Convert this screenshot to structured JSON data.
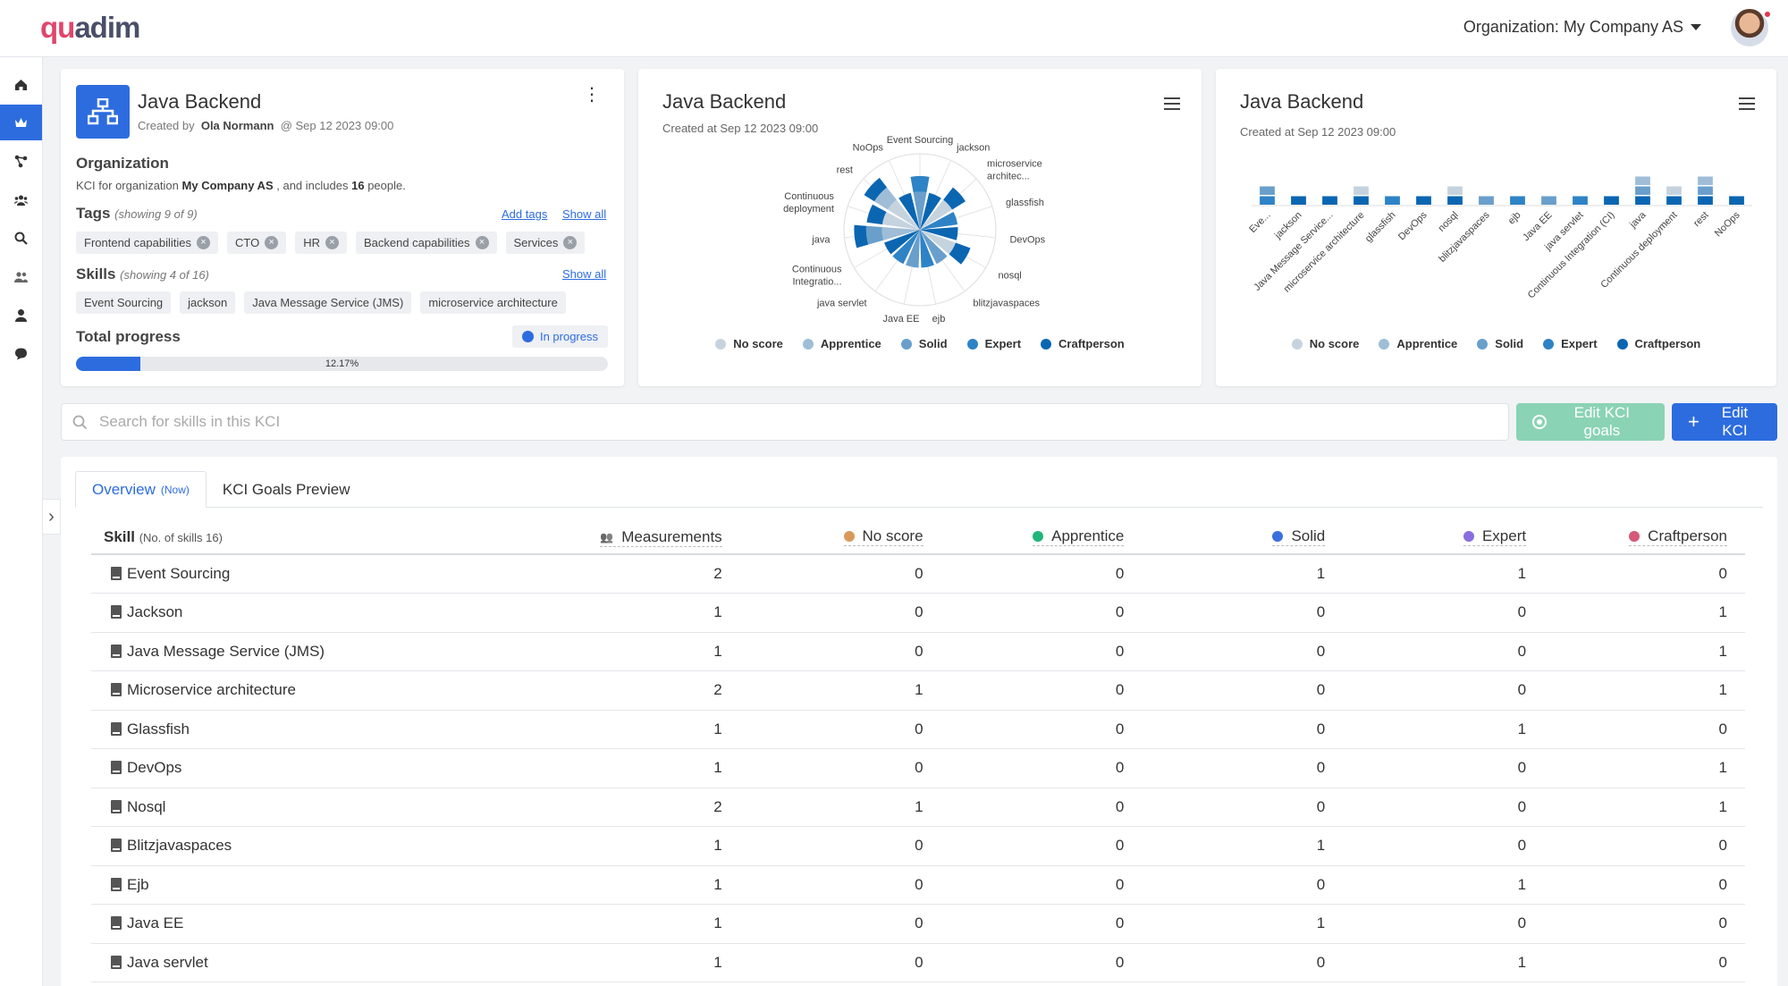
{
  "app": {
    "logo_text_a": "qu",
    "logo_text_b": "adim",
    "organization_label": "Organization: My Company AS"
  },
  "sidebar": {
    "items": [
      {
        "icon": "home-icon",
        "active": false
      },
      {
        "icon": "crown-icon",
        "active": true
      },
      {
        "icon": "graph-icon",
        "active": false
      },
      {
        "icon": "team-icon",
        "active": false
      },
      {
        "icon": "search-icon",
        "active": false
      },
      {
        "icon": "users-icon",
        "active": false
      },
      {
        "icon": "user-icon",
        "active": false
      },
      {
        "icon": "chat-icon",
        "active": false
      }
    ],
    "expander": "›"
  },
  "kci_card": {
    "title": "Java Backend",
    "created_prefix": "Created by",
    "created_by": "Ola Normann",
    "created_suffix": "@ Sep 12 2023 09:00",
    "organization_heading": "Organization",
    "org_desc_prefix": "KCI for organization",
    "org_name": "My Company AS",
    "org_desc_mid": ", and includes",
    "org_people": "16",
    "org_desc_suffix": "people.",
    "tags_heading": "Tags",
    "tags_note": "(showing 9 of 9)",
    "add_tags": "Add tags",
    "show_all_tags": "Show all",
    "tags": [
      "Frontend capabilities",
      "CTO",
      "HR",
      "Backend capabilities",
      "Services"
    ],
    "skills_heading": "Skills",
    "skills_note": "(showing 4 of 16)",
    "show_all_skills": "Show all",
    "skills": [
      "Event Sourcing",
      "jackson",
      "Java Message Service (JMS)",
      "microservice architecture"
    ],
    "progress_heading": "Total progress",
    "status": "In progress",
    "progress_fraction": 0.1217,
    "progress_label": "12.17%"
  },
  "colors": {
    "no_score": "#c5d3df",
    "apprentice": "#9fbdd7",
    "solid": "#6a9fcb",
    "expert": "#2e83c6",
    "craftperson": "#0b66b2",
    "accent": "#2d6cdf",
    "success": "#8ad3b5"
  },
  "legend": [
    "No score",
    "Apprentice",
    "Solid",
    "Expert",
    "Craftperson"
  ],
  "polar_card": {
    "title": "Java Backend",
    "subtitle": "Created at Sep 12 2023 09:00"
  },
  "bar_card": {
    "title": "Java Backend",
    "subtitle": "Created at Sep 12 2023 09:00"
  },
  "chart_data": [
    {
      "type": "polar-bar",
      "title": "Java Backend",
      "categories": [
        "Event Sourcing",
        "jackson",
        "microservice architec...",
        "glassfish",
        "DevOps",
        "nosql",
        "blitzjavaspaces",
        "ejb",
        "Java EE",
        "java servlet",
        "Continuous Integratio...",
        "java",
        "Continuous deployment",
        "rest",
        "NoOps"
      ],
      "series": [
        {
          "name": "No score",
          "values": [
            0,
            0,
            1,
            0,
            0,
            1,
            0,
            0,
            0,
            0,
            0,
            0,
            1,
            1,
            0
          ]
        },
        {
          "name": "Apprentice",
          "values": [
            0,
            0,
            0,
            0,
            0,
            0,
            0,
            0,
            0,
            0,
            0,
            1,
            0,
            1,
            0
          ]
        },
        {
          "name": "Solid",
          "values": [
            1,
            0,
            0,
            0,
            0,
            0,
            1,
            0,
            1,
            0,
            0,
            1,
            0,
            0,
            0
          ]
        },
        {
          "name": "Expert",
          "values": [
            1,
            0,
            0,
            1,
            0,
            0,
            0,
            1,
            0,
            1,
            0,
            0,
            0,
            0,
            0
          ]
        },
        {
          "name": "Craftperson",
          "values": [
            0,
            1,
            1,
            0,
            1,
            1,
            0,
            0,
            0,
            0,
            1,
            1,
            1,
            1,
            1
          ]
        }
      ],
      "legend_position": "bottom"
    },
    {
      "type": "bar",
      "title": "Java Backend",
      "categories": [
        "Eve...",
        "jackson",
        "Java Message Service...",
        "microservice architecture",
        "glassfish",
        "DevOps",
        "nosql",
        "blitzjavaspaces",
        "ejb",
        "Java EE",
        "java servlet",
        "Continuous Integration (CI)",
        "java",
        "Continuous deployment",
        "rest",
        "NoOps"
      ],
      "series": [
        {
          "name": "No score",
          "values": [
            0,
            0,
            0,
            1,
            0,
            0,
            1,
            0,
            0,
            0,
            0,
            0,
            0,
            1,
            0,
            0
          ]
        },
        {
          "name": "Apprentice",
          "values": [
            0,
            0,
            0,
            0,
            0,
            0,
            0,
            0,
            0,
            0,
            0,
            0,
            1,
            0,
            1,
            0
          ]
        },
        {
          "name": "Solid",
          "values": [
            1,
            0,
            0,
            0,
            0,
            0,
            0,
            1,
            0,
            1,
            0,
            0,
            1,
            0,
            1,
            0
          ]
        },
        {
          "name": "Expert",
          "values": [
            1,
            0,
            0,
            0,
            1,
            0,
            0,
            0,
            1,
            0,
            1,
            0,
            0,
            0,
            0,
            0
          ]
        },
        {
          "name": "Craftperson",
          "values": [
            0,
            1,
            1,
            1,
            0,
            1,
            1,
            0,
            0,
            0,
            0,
            1,
            1,
            1,
            1,
            1
          ]
        }
      ],
      "stacked": true,
      "legend_position": "bottom"
    }
  ],
  "search": {
    "placeholder": "Search for skills in this KCI",
    "value": ""
  },
  "actions": {
    "edit_goals": "Edit KCI goals",
    "edit_kci": "Edit KCI"
  },
  "tabs": [
    {
      "label": "Overview",
      "note": "(Now)"
    },
    {
      "label": "KCI Goals Preview",
      "note": ""
    }
  ],
  "table": {
    "skill_header": "Skill",
    "skill_count_note": "(No. of skills 16)",
    "columns": [
      "Measurements",
      "No score",
      "Apprentice",
      "Solid",
      "Expert",
      "Craftperson"
    ],
    "column_colors": [
      "",
      "#d79a5a",
      "#21b57a",
      "#3b6fe0",
      "#8a6ee0",
      "#d65878"
    ],
    "rows": [
      {
        "skill": "Event Sourcing",
        "values": [
          "2",
          "0",
          "0",
          "1",
          "1",
          "0"
        ]
      },
      {
        "skill": "Jackson",
        "values": [
          "1",
          "0",
          "0",
          "0",
          "0",
          "1"
        ]
      },
      {
        "skill": "Java Message Service (JMS)",
        "values": [
          "1",
          "0",
          "0",
          "0",
          "0",
          "1"
        ]
      },
      {
        "skill": "Microservice architecture",
        "values": [
          "2",
          "1",
          "0",
          "0",
          "0",
          "1"
        ]
      },
      {
        "skill": "Glassfish",
        "values": [
          "1",
          "0",
          "0",
          "0",
          "1",
          "0"
        ]
      },
      {
        "skill": "DevOps",
        "values": [
          "1",
          "0",
          "0",
          "0",
          "0",
          "1"
        ]
      },
      {
        "skill": "Nosql",
        "values": [
          "2",
          "1",
          "0",
          "0",
          "0",
          "1"
        ]
      },
      {
        "skill": "Blitzjavaspaces",
        "values": [
          "1",
          "0",
          "0",
          "1",
          "0",
          "0"
        ]
      },
      {
        "skill": "Ejb",
        "values": [
          "1",
          "0",
          "0",
          "0",
          "1",
          "0"
        ]
      },
      {
        "skill": "Java EE",
        "values": [
          "1",
          "0",
          "0",
          "1",
          "0",
          "0"
        ]
      },
      {
        "skill": "Java servlet",
        "values": [
          "1",
          "0",
          "0",
          "0",
          "1",
          "0"
        ]
      }
    ]
  }
}
